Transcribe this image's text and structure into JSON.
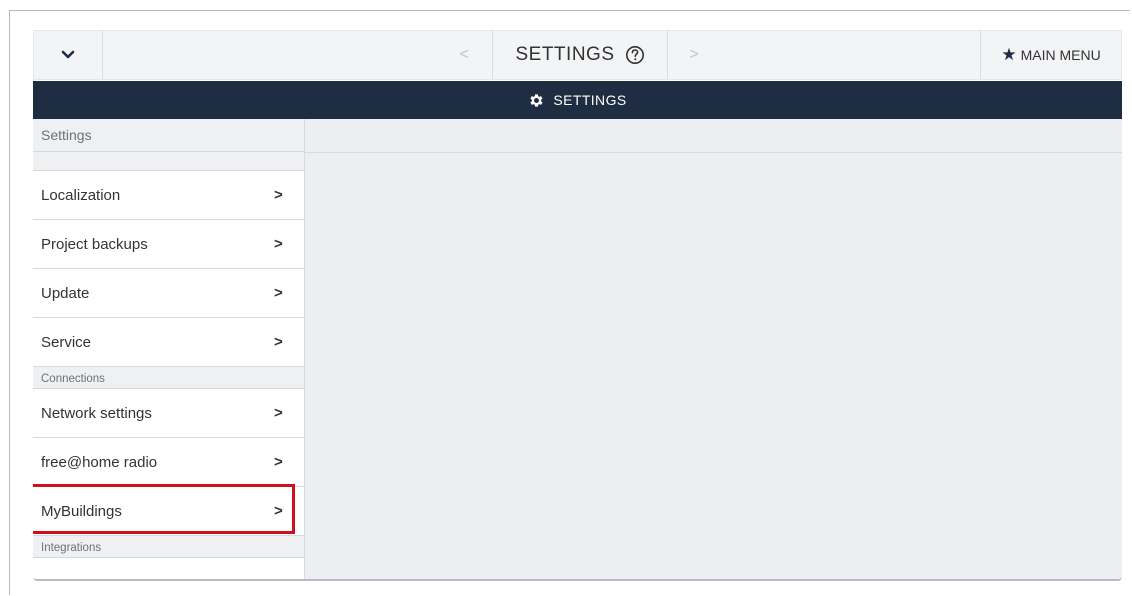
{
  "topbar": {
    "menu_toggle_icon": "chevron-down-icon",
    "prev_glyph": "<",
    "title": "SETTINGS",
    "help_icon": "help-circle-icon",
    "next_glyph": ">",
    "main_menu_label": "MAIN MENU",
    "main_menu_icon": "star-icon"
  },
  "panel": {
    "header_icon": "gear-icon",
    "header_title": "SETTINGS"
  },
  "sidebar": {
    "section_title": "Settings",
    "items": [
      {
        "label": "Localization",
        "chevron": ">"
      },
      {
        "label": "Project backups",
        "chevron": ">"
      },
      {
        "label": "Update",
        "chevron": ">"
      },
      {
        "label": "Service",
        "chevron": ">"
      }
    ],
    "connections_label": "Connections",
    "connection_items": [
      {
        "label": "Network settings",
        "chevron": ">"
      },
      {
        "label": "free@home radio",
        "chevron": ">"
      },
      {
        "label": "MyBuildings",
        "chevron": ">"
      }
    ],
    "integrations_label": "Integrations"
  },
  "colors": {
    "header_bg": "#1f2d42",
    "highlight": "#d1101d"
  }
}
